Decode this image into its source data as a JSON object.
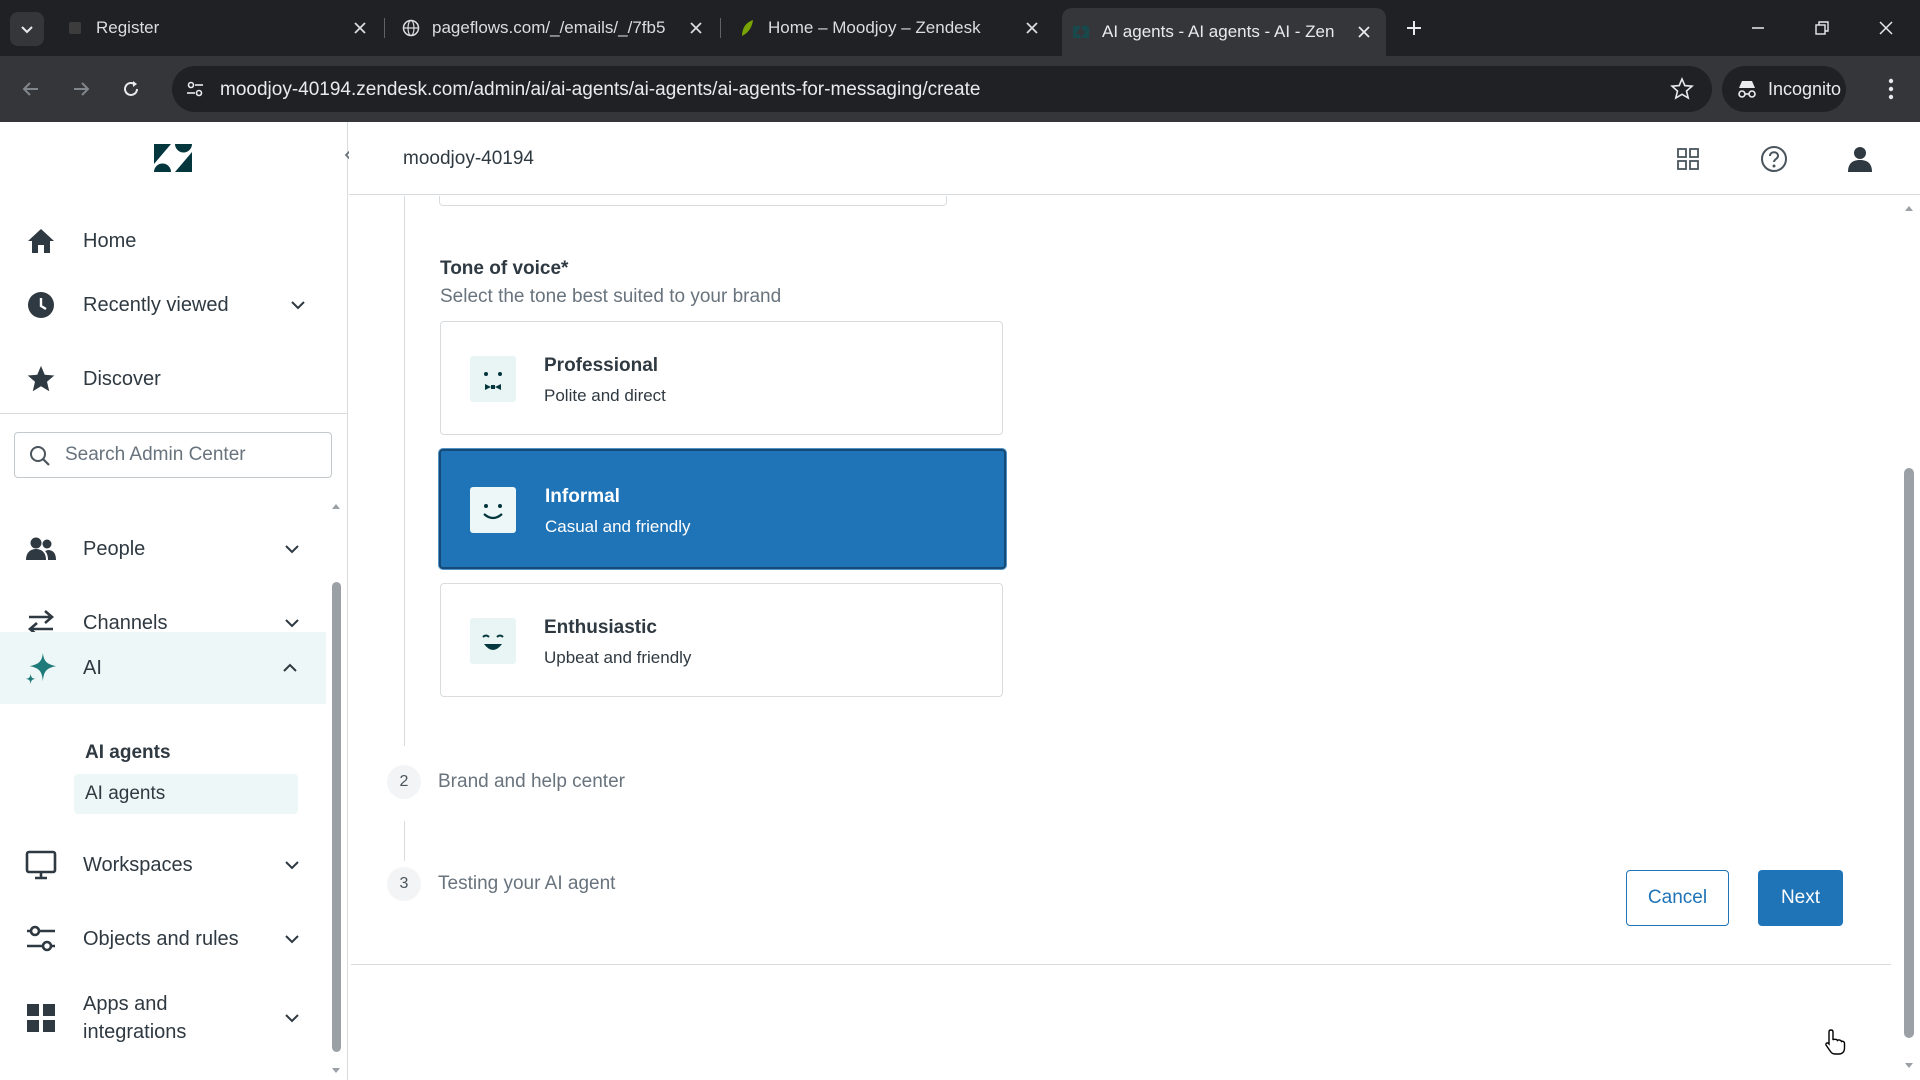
{
  "browser": {
    "tabs": [
      {
        "title": "Register"
      },
      {
        "title": "pageflows.com/_/emails/_/7fb5"
      },
      {
        "title": "Home – Moodjoy – Zendesk"
      },
      {
        "title": "AI agents - AI agents - AI - Zen"
      }
    ],
    "active_tab": 3,
    "url": "moodjoy-40194.zendesk.com/admin/ai/ai-agents/ai-agents/ai-agents-for-messaging/create",
    "incognito_label": "Incognito"
  },
  "sidebar": {
    "top_items": [
      {
        "label": "Home",
        "icon": "home-icon"
      },
      {
        "label": "Recently viewed",
        "icon": "clock-icon"
      },
      {
        "label": "Discover",
        "icon": "star-icon"
      }
    ],
    "search_placeholder": "Search Admin Center",
    "items": [
      {
        "label": "People",
        "icon": "people-icon"
      },
      {
        "label": "Channels",
        "icon": "channels-icon"
      },
      {
        "label": "AI",
        "icon": "ai-sparkle-icon"
      },
      {
        "label": "Workspaces",
        "icon": "workspaces-icon"
      },
      {
        "label": "Objects and rules",
        "icon": "objects-rules-icon"
      },
      {
        "label": "Apps and integrations",
        "icon": "apps-icon"
      }
    ],
    "ai_subheader": "AI agents",
    "ai_subitem": "AI agents"
  },
  "header": {
    "account": "moodjoy-40194"
  },
  "form": {
    "tone_label": "Tone of voice*",
    "tone_hint": "Select the tone best suited to your brand",
    "options": [
      {
        "title": "Professional",
        "desc": "Polite and direct",
        "selected": false
      },
      {
        "title": "Informal",
        "desc": "Casual and friendly",
        "selected": true
      },
      {
        "title": "Enthusiastic",
        "desc": "Upbeat and friendly",
        "selected": false
      }
    ],
    "steps": [
      {
        "number": "2",
        "title": "Brand and help center"
      },
      {
        "number": "3",
        "title": "Testing your AI agent"
      }
    ]
  },
  "footer": {
    "cancel_label": "Cancel",
    "next_label": "Next"
  },
  "colors": {
    "primary": "#1f73b7",
    "selected_nav_bg": "#edf7f7",
    "chrome_dark": "#202124"
  }
}
